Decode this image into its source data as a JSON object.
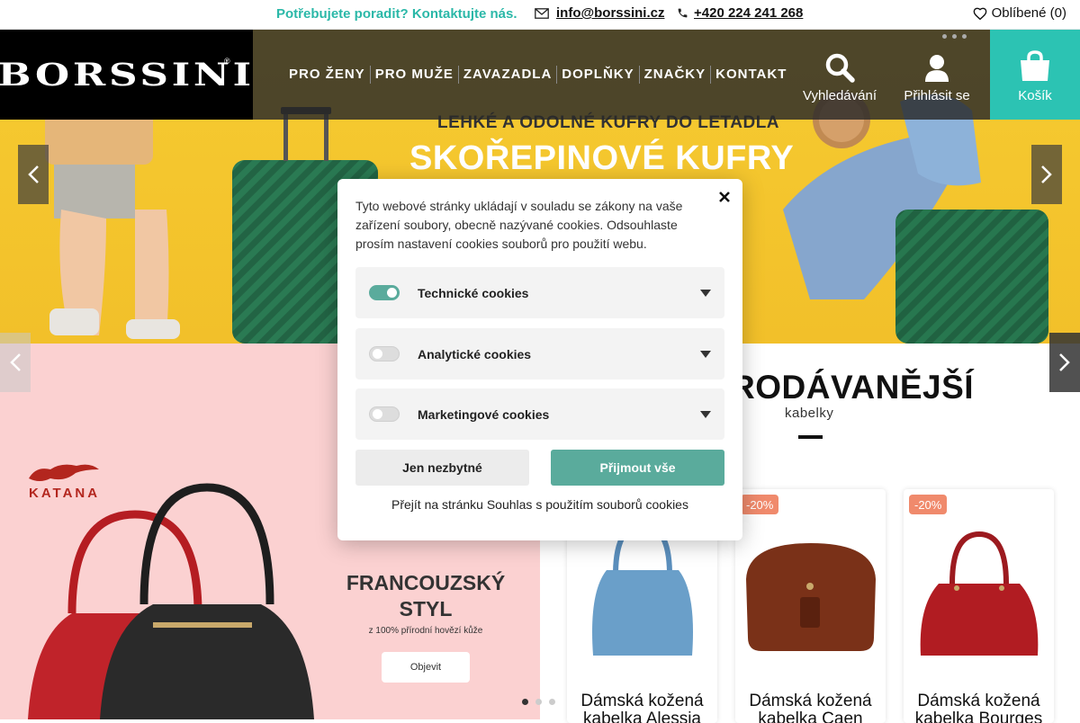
{
  "topbar": {
    "help_text": "Potřebujete poradit?  Kontaktujte nás.",
    "email": "info@borssini.cz",
    "phone": "+420 224 241 268",
    "favorites_label": "Oblíbené (0)"
  },
  "header": {
    "logo": "BORSSINI",
    "logo_mark": "®",
    "nav": [
      {
        "label": "PRO ŽENY"
      },
      {
        "label": "PRO MUŽE"
      },
      {
        "label": "ZAVAZADLA"
      },
      {
        "label": "DOPLŇKY"
      },
      {
        "label": "ZNAČKY"
      },
      {
        "label": "KONTAKT"
      }
    ],
    "search_label": "Vyhledávání",
    "login_label": "Přihlásit se",
    "cart_label": "Košík",
    "accent_color": "#2cc3b3"
  },
  "hero": {
    "subtitle": "LEHKÉ A ODOLNÉ KUFRY DO LETADLA",
    "title": "SKOŘEPINOVÉ KUFRY"
  },
  "promo": {
    "brand": "KATANA",
    "title_line1": "FRANCOUZSKÝ",
    "title_line2": "STYL",
    "subtitle": "z 100% přírodní hovězí kůže",
    "button": "Objevit"
  },
  "bestsellers": {
    "title": "RODÁVANĚJŠÍ",
    "subtitle": "kabelky",
    "products": [
      {
        "badge": "",
        "name_line1": "Dámská kožená",
        "name_line2": "kabelka Alessia",
        "color": "#6a9fc9"
      },
      {
        "badge": "-20%",
        "name_line1": "Dámská kožená",
        "name_line2": "kabelka Caen",
        "color": "#7a3118"
      },
      {
        "badge": "-20%",
        "name_line1": "Dámská kožená",
        "name_line2": "kabelka Bourges",
        "color": "#b11c22"
      }
    ]
  },
  "cookie_modal": {
    "intro": "Tyto webové stránky ukládají v souladu se zákony na vaše zařízení soubory, obecně nazývané cookies. Odsouhlaste prosím nastavení cookies souborů pro použití webu.",
    "categories": [
      {
        "label": "Technické cookies",
        "enabled": true
      },
      {
        "label": "Analytické cookies",
        "enabled": false
      },
      {
        "label": "Marketingové cookies",
        "enabled": false
      }
    ],
    "btn_necessary": "Jen nezbytné",
    "btn_accept_all": "Přijmout vše",
    "link": "Přejít na stránku Souhlas s použitím souborů cookies",
    "accent_color": "#5aab9c"
  }
}
